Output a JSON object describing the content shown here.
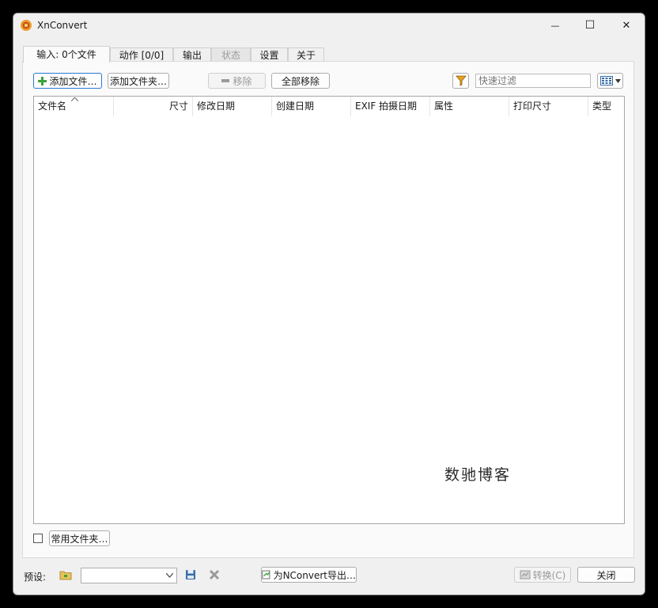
{
  "window": {
    "title": "XnConvert",
    "minimize_glyph": "—",
    "maximize_glyph": "☐",
    "close_glyph": "✕"
  },
  "tabs": [
    {
      "label": "输入: 0个文件",
      "state": "active"
    },
    {
      "label": "动作 [0/0]",
      "state": "normal"
    },
    {
      "label": "输出",
      "state": "normal"
    },
    {
      "label": "状态",
      "state": "disabled"
    },
    {
      "label": "设置",
      "state": "normal"
    },
    {
      "label": "关于",
      "state": "normal"
    }
  ],
  "toolbar": {
    "add_files": "添加文件…",
    "add_folder": "添加文件夹…",
    "remove": "移除",
    "remove_all": "全部移除",
    "filter_placeholder": "快速过滤"
  },
  "file_list": {
    "columns": [
      "文件名",
      "尺寸",
      "修改日期",
      "创建日期",
      "EXIF 拍摄日期",
      "属性",
      "打印尺寸",
      "类型"
    ],
    "rows": []
  },
  "watermark": "数驰博客",
  "favorites": {
    "checkbox_checked": false,
    "button": "常用文件夹…"
  },
  "bottom": {
    "preset_label": "预设:",
    "preset_value": "",
    "export_button": "为NConvert导出…",
    "convert_button": "转换(C)",
    "close_button": "关闭"
  },
  "colors": {
    "window_bg": "#f0f0f0",
    "focus_border": "#2a7bd4",
    "add_icon_green": "#3aa23a",
    "filter_icon_orange": "#e8a020"
  }
}
